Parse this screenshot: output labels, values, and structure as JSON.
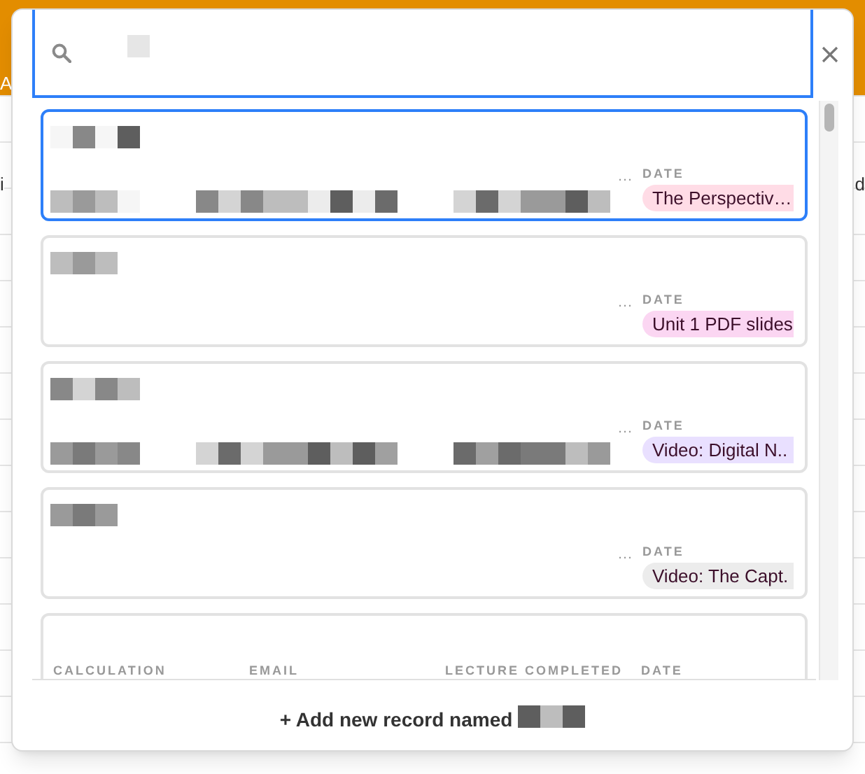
{
  "background": {
    "header_fragment": "A",
    "left_fragment": "i",
    "right_fragment": "d"
  },
  "records": [
    {
      "selected": true,
      "more": "…",
      "date_label": "DATE",
      "date_value": "The Perspectiv…",
      "color": "#ffdce6"
    },
    {
      "selected": false,
      "more": "…",
      "date_label": "DATE",
      "date_value": "Unit 1 PDF slides",
      "color": "#fbd6f2"
    },
    {
      "selected": false,
      "more": "…",
      "date_label": "DATE",
      "date_value": "Video: Digital N..",
      "color": "#e9e0ff"
    },
    {
      "selected": false,
      "more": "…",
      "date_label": "DATE",
      "date_value": "Video: The Capt.",
      "color": "#ececec"
    }
  ],
  "last_record_headers": [
    "CALCULATION",
    "EMAIL",
    "LECTURE COMPLETED",
    "DATE"
  ],
  "footer": {
    "label": "+ Add new record named"
  }
}
